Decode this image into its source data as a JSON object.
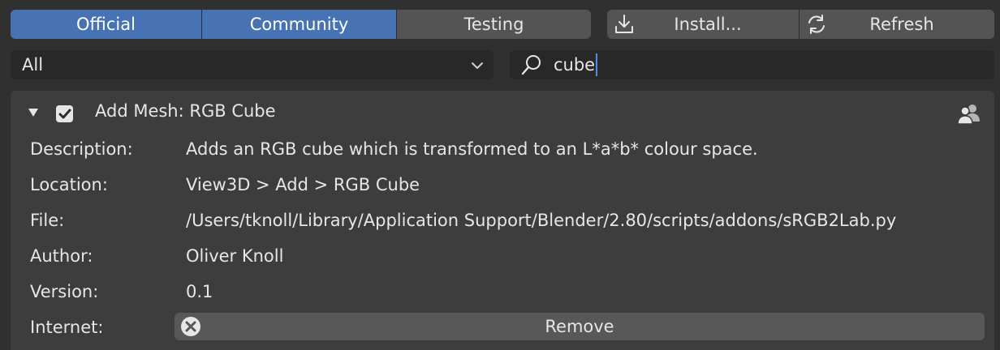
{
  "tabs": [
    {
      "label": "Official",
      "active": true
    },
    {
      "label": "Community",
      "active": true
    },
    {
      "label": "Testing",
      "active": false
    }
  ],
  "actions": {
    "install_label": "Install...",
    "refresh_label": "Refresh",
    "install_icon": "download-icon",
    "refresh_icon": "refresh-icon"
  },
  "filter": {
    "category_value": "All"
  },
  "search": {
    "value": "cube",
    "icon": "search-icon"
  },
  "addon": {
    "title": "Add Mesh: RGB Cube",
    "enabled": true,
    "expanded": true,
    "details": [
      {
        "key": "Description:",
        "value": "Adds an RGB cube which is transformed to an L*a*b* colour space."
      },
      {
        "key": "Location:",
        "value": "View3D > Add > RGB Cube"
      },
      {
        "key": "File:",
        "value": "/Users/tknoll/Library/Application Support/Blender/2.80/scripts/addons/sRGB2Lab.py"
      },
      {
        "key": "Author:",
        "value": "Oliver Knoll"
      },
      {
        "key": "Version:",
        "value": "0.1"
      }
    ],
    "internet_label": "Internet:",
    "remove_label": "Remove"
  },
  "colors": {
    "active_tab": "#4772b3",
    "button": "#545454",
    "panel": "#3d3d3d",
    "field": "#282828",
    "caret": "#4a90e8"
  }
}
